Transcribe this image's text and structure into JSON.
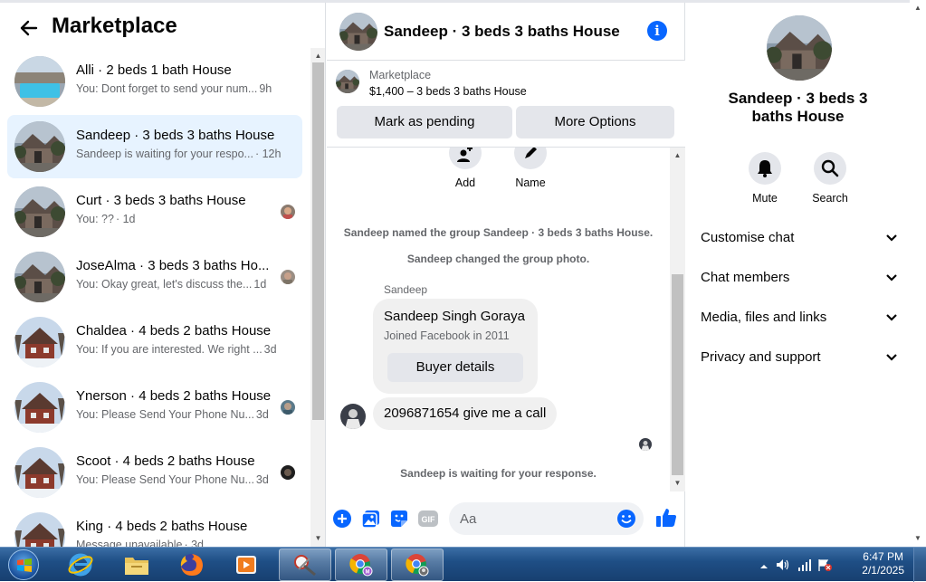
{
  "sidebar": {
    "title": "Marketplace",
    "conversations": [
      {
        "name": "Alli · 2 beds 1 bath House",
        "preview": "You: Dont forget to send your num...",
        "time": "9h"
      },
      {
        "name": "Sandeep · 3 beds 3 baths House",
        "preview": "Sandeep is waiting for your respo...",
        "time": "· 12h"
      },
      {
        "name": "Curt · 3 beds 3 baths House",
        "preview": "You: ??",
        "time": "· 1d"
      },
      {
        "name": "JoseAlma · 3 beds 3 baths Ho...",
        "preview": "You: Okay great, let's discuss the...",
        "time": "1d"
      },
      {
        "name": "Chaldea · 4 beds 2 baths House",
        "preview": "You: If you are interested. We right ...",
        "time": "3d"
      },
      {
        "name": "Ynerson · 4 beds 2 baths House",
        "preview": "You: Please Send Your Phone Nu...",
        "time": "3d"
      },
      {
        "name": "Scoot · 4 beds 2 baths House",
        "preview": "You: Please Send Your Phone Nu...",
        "time": "3d"
      },
      {
        "name": "King · 4 beds 2 baths House",
        "preview": "Message unavailable",
        "time": "· 3d"
      }
    ]
  },
  "chat": {
    "title": "Sandeep · 3 beds 3 baths House",
    "marketplace_label": "Marketplace",
    "listing": "$1,400 – 3 beds 3 baths House",
    "mark_pending": "Mark as pending",
    "more_options": "More Options",
    "add_label": "Add",
    "name_label": "Name",
    "system_1": "Sandeep named the group Sandeep · 3 beds 3 baths House.",
    "system_2": "Sandeep changed the group photo.",
    "sender": "Sandeep",
    "profile_name": "Sandeep Singh Goraya",
    "profile_sub": "Joined Facebook in 2011",
    "buyer_details": "Buyer details",
    "message": "2096871654 give me a call",
    "waiting": "Sandeep is waiting for your response.",
    "input_placeholder": "Aa"
  },
  "details": {
    "title": "Sandeep · 3 beds 3 baths House",
    "mute_label": "Mute",
    "search_label": "Search",
    "sections": [
      "Customise chat",
      "Chat members",
      "Media, files and links",
      "Privacy and support"
    ]
  },
  "taskbar": {
    "time": "6:47 PM",
    "date": "2/1/2025"
  },
  "colors": {
    "accent": "#0866ff",
    "active_row": "#e7f3ff",
    "bubble": "#f0f0f0"
  }
}
